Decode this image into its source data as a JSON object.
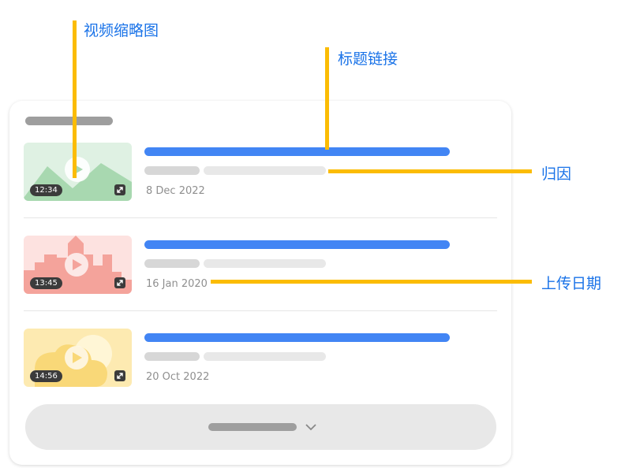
{
  "colors": {
    "accent_blue": "#4285f4",
    "callout_yellow": "#fbbc04",
    "label_blue": "#1a73e8",
    "thumb_green": "#dff1e3",
    "thumb_red": "#fde2e0",
    "thumb_yellow": "#fdeab1"
  },
  "callouts": {
    "thumbnail": "视频缩略图",
    "title_link": "标题链接",
    "attribution": "归因",
    "upload_date": "上传日期"
  },
  "videos": [
    {
      "duration": "12:34",
      "date": "8 Dec 2022",
      "theme": "green",
      "icon": "landscape-mountains"
    },
    {
      "duration": "13:45",
      "date": "16 Jan 2020",
      "theme": "red",
      "icon": "city-skyline"
    },
    {
      "duration": "14:56",
      "date": "20 Oct 2022",
      "theme": "yellow",
      "icon": "cloud-sun"
    }
  ],
  "icons": {
    "play": "play-icon",
    "expand": "expand-icon",
    "chevron": "chevron-down-icon"
  }
}
